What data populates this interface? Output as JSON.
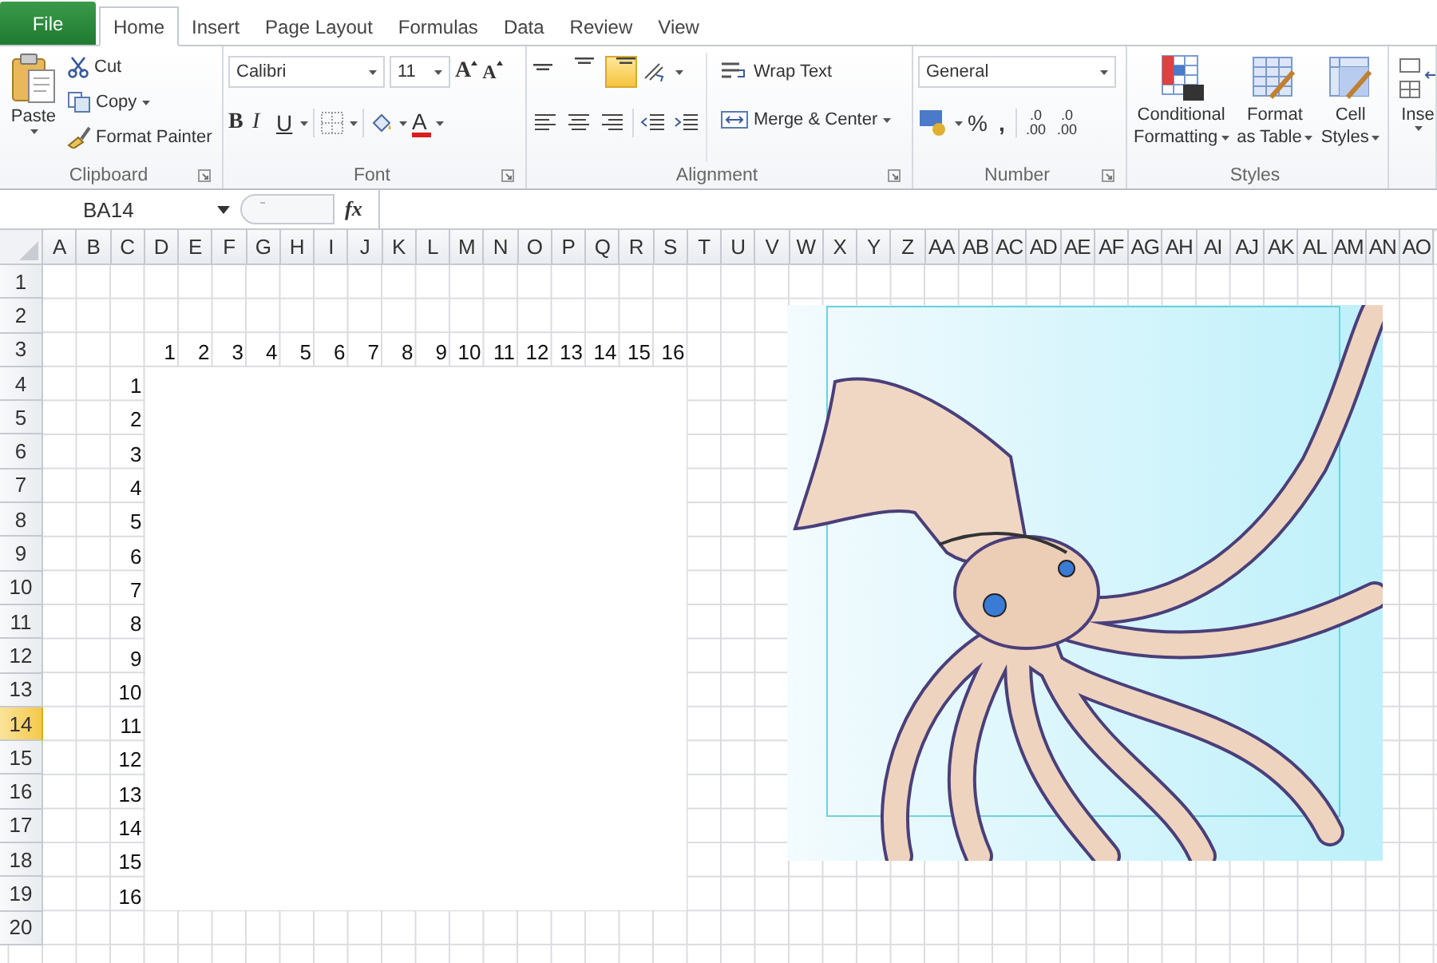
{
  "file_tab": {
    "label": "File"
  },
  "tabs": [
    {
      "label": "Home",
      "selected": true
    },
    {
      "label": "Insert",
      "selected": false
    },
    {
      "label": "Page Layout",
      "selected": false
    },
    {
      "label": "Formulas",
      "selected": false
    },
    {
      "label": "Data",
      "selected": false
    },
    {
      "label": "Review",
      "selected": false
    },
    {
      "label": "View",
      "selected": false
    }
  ],
  "clipboard": {
    "paste": "Paste",
    "cut": "Cut",
    "copy": "Copy",
    "format_painter": "Format Painter",
    "label": "Clipboard"
  },
  "font": {
    "name": "Calibri",
    "size": "11",
    "grow": "A",
    "shrink": "A",
    "bold": "B",
    "italic": "I",
    "underline": "U",
    "font_color_label": "A",
    "label": "Font"
  },
  "alignment": {
    "vertical": [
      {
        "selected": false
      },
      {
        "selected": false
      },
      {
        "selected": true
      }
    ],
    "wrap_text": "Wrap Text",
    "merge_center": "Merge & Center",
    "label": "Alignment"
  },
  "number": {
    "format": "General",
    "percent": "%",
    "comma": ",",
    "decimals": [
      {
        "top": ".0",
        "bottom": ".00"
      },
      {
        "top": ".0",
        "bottom": ".00"
      }
    ],
    "label": "Number"
  },
  "styles": {
    "buttons": [
      {
        "kind": "conditional",
        "lines": [
          "Conditional",
          "Formatting"
        ]
      },
      {
        "kind": "table",
        "lines": [
          "Format",
          "as Table"
        ]
      },
      {
        "kind": "cell",
        "lines": [
          "Cell",
          "Styles"
        ]
      }
    ],
    "label": "Styles"
  },
  "cells_group": {
    "insert": "Inse"
  },
  "formula_bar": {
    "name_box": "BA14",
    "function_label": "fx"
  },
  "sheet": {
    "columns": [
      "A",
      "B",
      "C",
      "D",
      "E",
      "F",
      "G",
      "H",
      "I",
      "J",
      "K",
      "L",
      "M",
      "N",
      "O",
      "P",
      "Q",
      "R",
      "S",
      "T",
      "U",
      "V",
      "W",
      "X",
      "Y",
      "Z",
      "AA",
      "AB",
      "AC",
      "AD",
      "AE",
      "AF",
      "AG",
      "AH",
      "AI",
      "AJ",
      "AK",
      "AL",
      "AM",
      "AN",
      "AO"
    ],
    "rows": [
      {
        "label": "1",
        "selected": false
      },
      {
        "label": "2",
        "selected": false
      },
      {
        "label": "3",
        "selected": false
      },
      {
        "label": "4",
        "selected": false
      },
      {
        "label": "5",
        "selected": false
      },
      {
        "label": "6",
        "selected": false
      },
      {
        "label": "7",
        "selected": false
      },
      {
        "label": "8",
        "selected": false
      },
      {
        "label": "9",
        "selected": false
      },
      {
        "label": "10",
        "selected": false
      },
      {
        "label": "11",
        "selected": false
      },
      {
        "label": "12",
        "selected": false
      },
      {
        "label": "13",
        "selected": false
      },
      {
        "label": "14",
        "selected": true
      },
      {
        "label": "15",
        "selected": false
      },
      {
        "label": "16",
        "selected": false
      },
      {
        "label": "17",
        "selected": false
      },
      {
        "label": "18",
        "selected": false
      },
      {
        "label": "19",
        "selected": false
      },
      {
        "label": "20",
        "selected": false
      }
    ],
    "top_labels": [
      "1",
      "2",
      "3",
      "4",
      "5",
      "6",
      "7",
      "8",
      "9",
      "10",
      "11",
      "12",
      "13",
      "14",
      "15",
      "16"
    ],
    "side_labels": [
      "1",
      "2",
      "3",
      "4",
      "5",
      "6",
      "7",
      "8",
      "9",
      "10",
      "11",
      "12",
      "13",
      "14",
      "15",
      "16"
    ]
  }
}
